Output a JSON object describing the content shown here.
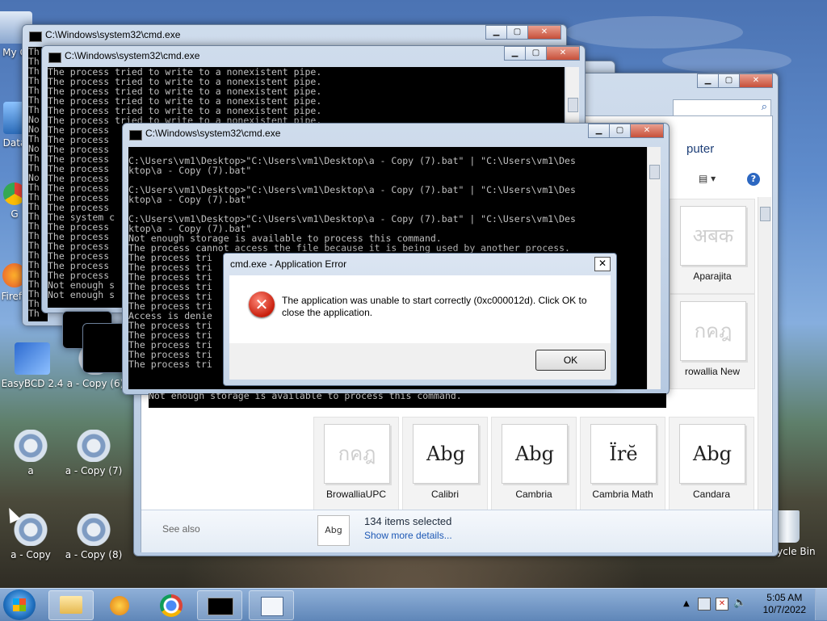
{
  "desktop_icons": [
    {
      "label": "My C"
    },
    {
      "label": "Data"
    },
    {
      "label": "G"
    },
    {
      "label": "Firefo"
    },
    {
      "label": "EasyBCD 2.4"
    },
    {
      "label": "a - Copy (6)"
    },
    {
      "label": "a"
    },
    {
      "label": "a - Copy (7)"
    },
    {
      "label": "a - Copy"
    },
    {
      "label": "a - Copy (8)"
    },
    {
      "label": "Recycle Bin"
    }
  ],
  "cmd_back": {
    "title": "C:\\Windows\\system32\\cmd.exe",
    "lines": "Th\nTh\nTh\nTh\nTh\nTh\nTh\nNo\nNo\nTh\nNo\nTh\nTh\nNo\nTh\nTh\nTh\nTh\nTh\nTh\nTh\nTh\nTh\nTh\nTh\nTh\nTh\nTh"
  },
  "cmd_mid": {
    "title": "C:\\Windows\\system32\\cmd.exe",
    "lines": "The process tried to write to a nonexistent pipe.\nThe process tried to write to a nonexistent pipe.\nThe process tried to write to a nonexistent pipe.\nThe process tried to write to a nonexistent pipe.\nThe process tried to write to a nonexistent pipe.\nThe process tried to write to a nonexistent pipe.\nThe process\nThe process\nThe process\nThe process\nThe process\nThe process\nThe process\nThe process\nThe process\nThe system c\nThe process\nThe process\nThe process\nThe process\nThe process\nThe process\nNot enough s\nNot enough s"
  },
  "cmd_front": {
    "title": "C:\\Windows\\system32\\cmd.exe",
    "lines": "C:\\Users\\vm1\\Desktop>\"C:\\Users\\vm1\\Desktop\\a - Copy (7).bat\" | \"C:\\Users\\vm1\\Des\nktop\\a - Copy (7).bat\"\n\nC:\\Users\\vm1\\Desktop>\"C:\\Users\\vm1\\Desktop\\a - Copy (7).bat\" | \"C:\\Users\\vm1\\Des\nktop\\a - Copy (7).bat\"\n\nC:\\Users\\vm1\\Desktop>\"C:\\Users\\vm1\\Desktop\\a - Copy (7).bat\" | \"C:\\Users\\vm1\\Des\nktop\\a - Copy (7).bat\"\nNot enough storage is available to process this command.\nThe process cannot access the file because it is being used by another process.\nThe process tri\nThe process tri\nThe process tri\nThe process tri\nThe process tri\nThe process tri\nAccess is denie\nThe process tri\nThe process tri\nThe process tri\nThe process tri\nThe process tri",
    "below_line": "Not enough storage is available to process this command."
  },
  "explorer": {
    "partial_title": "puter",
    "fonts": [
      {
        "sample": "अबक",
        "name": "Aparajita"
      },
      {
        "sample": "กคฎ",
        "name": "rowallia New"
      },
      {
        "sample": "กคฎ",
        "name": "BrowalliaUPC"
      },
      {
        "sample": "Abg",
        "name": "Calibri"
      },
      {
        "sample": "Abg",
        "name": "Cambria"
      },
      {
        "sample": "Ïrĕ",
        "name": "Cambria Math"
      },
      {
        "sample": "Abg",
        "name": "Candara"
      }
    ],
    "see_also": "See also",
    "status_icon_text": "Abg",
    "status_count": "134 items selected",
    "status_link": "Show more details..."
  },
  "dialog": {
    "title": "cmd.exe - Application Error",
    "close_glyph": "✕",
    "error_glyph": "✕",
    "message": "The application was unable to start correctly (0xc000012d). Click OK to close the application.",
    "ok_label": "OK"
  },
  "taskbar": {
    "time": "5:05 AM",
    "date": "10/7/2022"
  }
}
